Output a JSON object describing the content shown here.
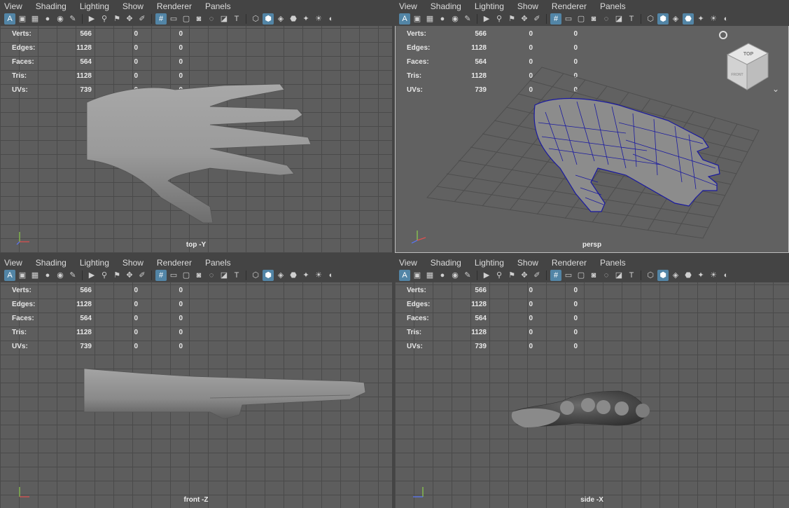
{
  "menus": [
    "View",
    "Shading",
    "Lighting",
    "Show",
    "Renderer",
    "Panels"
  ],
  "hud": {
    "rows": [
      {
        "label": "Verts:",
        "v1": "566",
        "v2": "0",
        "v3": "0"
      },
      {
        "label": "Edges:",
        "v1": "1128",
        "v2": "0",
        "v3": "0"
      },
      {
        "label": "Faces:",
        "v1": "564",
        "v2": "0",
        "v3": "0"
      },
      {
        "label": "Tris:",
        "v1": "1128",
        "v2": "0",
        "v3": "0"
      },
      {
        "label": "UVs:",
        "v1": "739",
        "v2": "0",
        "v3": "0"
      }
    ]
  },
  "panels": {
    "top": {
      "label": "top -Y"
    },
    "persp": {
      "label": "persp"
    },
    "front": {
      "label": "front -Z"
    },
    "side": {
      "label": "side -X"
    }
  },
  "viewcube": {
    "face_top": "TOP",
    "face_front": "FRONT"
  },
  "colors": {
    "accent": "#5285a6",
    "wireframe": "#1a1aa0",
    "grid": "#4a4a4a",
    "menubar": "#444444"
  }
}
